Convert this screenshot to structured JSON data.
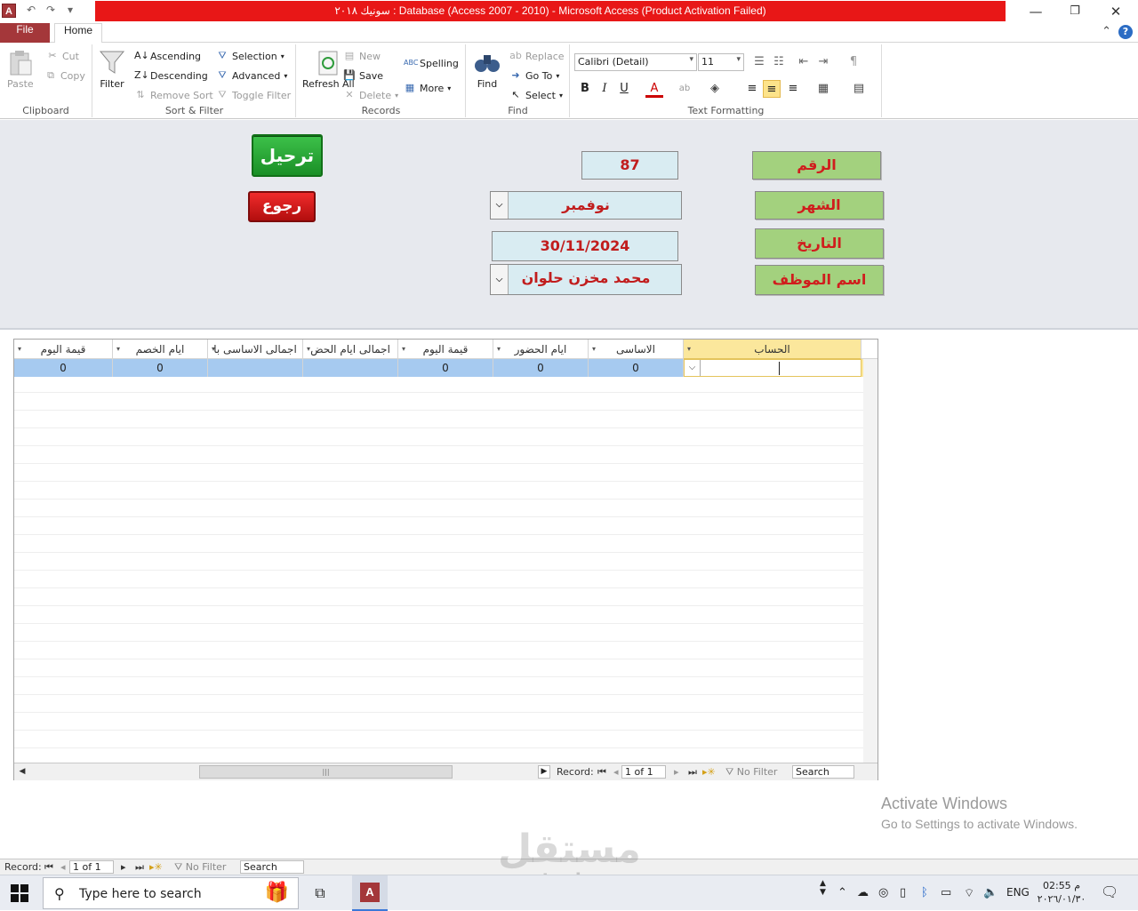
{
  "window": {
    "title": "سونيك ٢٠١٨ : Database (Access 2007 - 2010)  -  Microsoft Access (Product Activation Failed)",
    "app_icon": "A",
    "minimize": "—",
    "restore": "❐",
    "close": "✕"
  },
  "tabs": {
    "file": "File",
    "home": "Home"
  },
  "ribbon": {
    "clipboard": {
      "label": "Clipboard",
      "paste": "Paste",
      "cut": "Cut",
      "copy": "Copy"
    },
    "sort_filter": {
      "label": "Sort & Filter",
      "filter": "Filter",
      "ascending": "Ascending",
      "descending": "Descending",
      "remove_sort": "Remove Sort",
      "selection": "Selection",
      "advanced": "Advanced",
      "toggle_filter": "Toggle Filter"
    },
    "records": {
      "label": "Records",
      "refresh_all": "Refresh All",
      "new": "New",
      "save": "Save",
      "delete": "Delete",
      "spelling": "Spelling",
      "more": "More"
    },
    "find": {
      "label": "Find",
      "find": "Find",
      "replace": "Replace",
      "goto": "Go To",
      "select": "Select"
    },
    "text_formatting": {
      "label": "Text Formatting",
      "font": "Calibri (Detail)",
      "size": "11",
      "bold": "B",
      "italic": "I",
      "underline": "U"
    }
  },
  "form": {
    "labels": {
      "number": "الرقم",
      "month": "الشهر",
      "date": "التاريخ",
      "employee": "اسم الموظف"
    },
    "values": {
      "number": "87",
      "month": "نوفمبر",
      "date": "30/11/2024",
      "employee": "محمد مخزن حلوان"
    },
    "buttons": {
      "post": "ترحيل",
      "back": "رجوع"
    }
  },
  "datasheet": {
    "columns": [
      "الحساب",
      "الاساسى",
      "ايام الحضور",
      "قيمة اليوم",
      "اجمالى ايام الحض",
      "اجمالى الاساسى با",
      "ايام الخصم",
      "قيمة اليوم"
    ],
    "row": [
      "",
      "0",
      "0",
      "0",
      "",
      "",
      "0",
      "0"
    ],
    "new_record_marker": "✳",
    "nav": {
      "record_label": "Record:",
      "position": "1 of 1",
      "no_filter": "No Filter",
      "search": "Search"
    }
  },
  "activation": {
    "line1": "Activate Windows",
    "line2": "Go to Settings to activate Windows."
  },
  "statusbar": {
    "record_label": "Record:",
    "position": "1 of 1",
    "no_filter": "No Filter",
    "search": "Search"
  },
  "watermark": {
    "arabic": "مستقل",
    "latin": "mostaql.com"
  },
  "taskbar": {
    "search_placeholder": "Type here to search",
    "lang": "ENG",
    "time": "02:55 م",
    "date": "٢٠٢٦/٠١/٣٠"
  }
}
